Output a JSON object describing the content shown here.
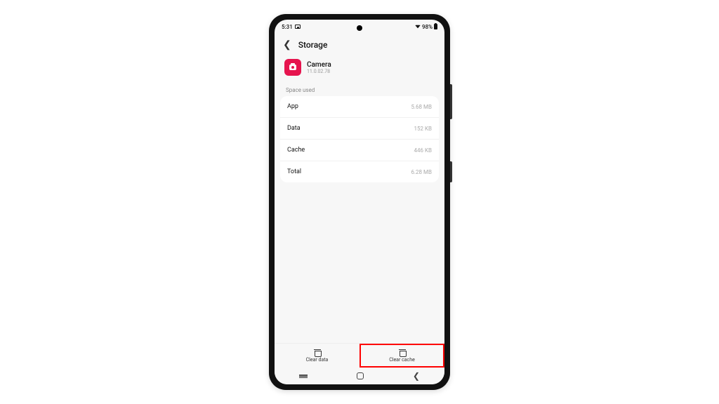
{
  "status": {
    "time": "5:31",
    "battery_pct": "98%"
  },
  "header": {
    "title": "Storage"
  },
  "app": {
    "name": "Camera",
    "version": "11.0.02.78",
    "icon_color": "#e6144e"
  },
  "section": {
    "label": "Space used",
    "rows": [
      {
        "label": "App",
        "value": "5.68 MB"
      },
      {
        "label": "Data",
        "value": "152 KB"
      },
      {
        "label": "Cache",
        "value": "446 KB"
      },
      {
        "label": "Total",
        "value": "6.28 MB"
      }
    ]
  },
  "actions": {
    "clear_data": "Clear data",
    "clear_cache": "Clear cache"
  }
}
